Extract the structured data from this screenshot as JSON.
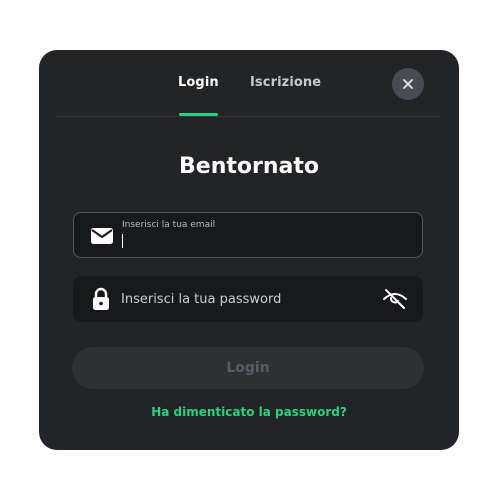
{
  "tabs": {
    "login_label": "Login",
    "signup_label": "Iscrizione"
  },
  "close_icon": "close-icon",
  "heading": "Bentornato",
  "email_field": {
    "label": "Inserisci la tua email",
    "value": "",
    "icon": "envelope-icon"
  },
  "password_field": {
    "placeholder": "Inserisci la tua password",
    "value": "",
    "icon": "lock-icon",
    "toggle_icon": "eye-off-icon"
  },
  "login_button": {
    "label": "Login"
  },
  "forgot_link": "Ha dimenticato la password?",
  "colors": {
    "accent": "#2fd07d",
    "modal_background": "#232428",
    "field_background": "#18191c",
    "disabled_button": "#2e3034"
  }
}
